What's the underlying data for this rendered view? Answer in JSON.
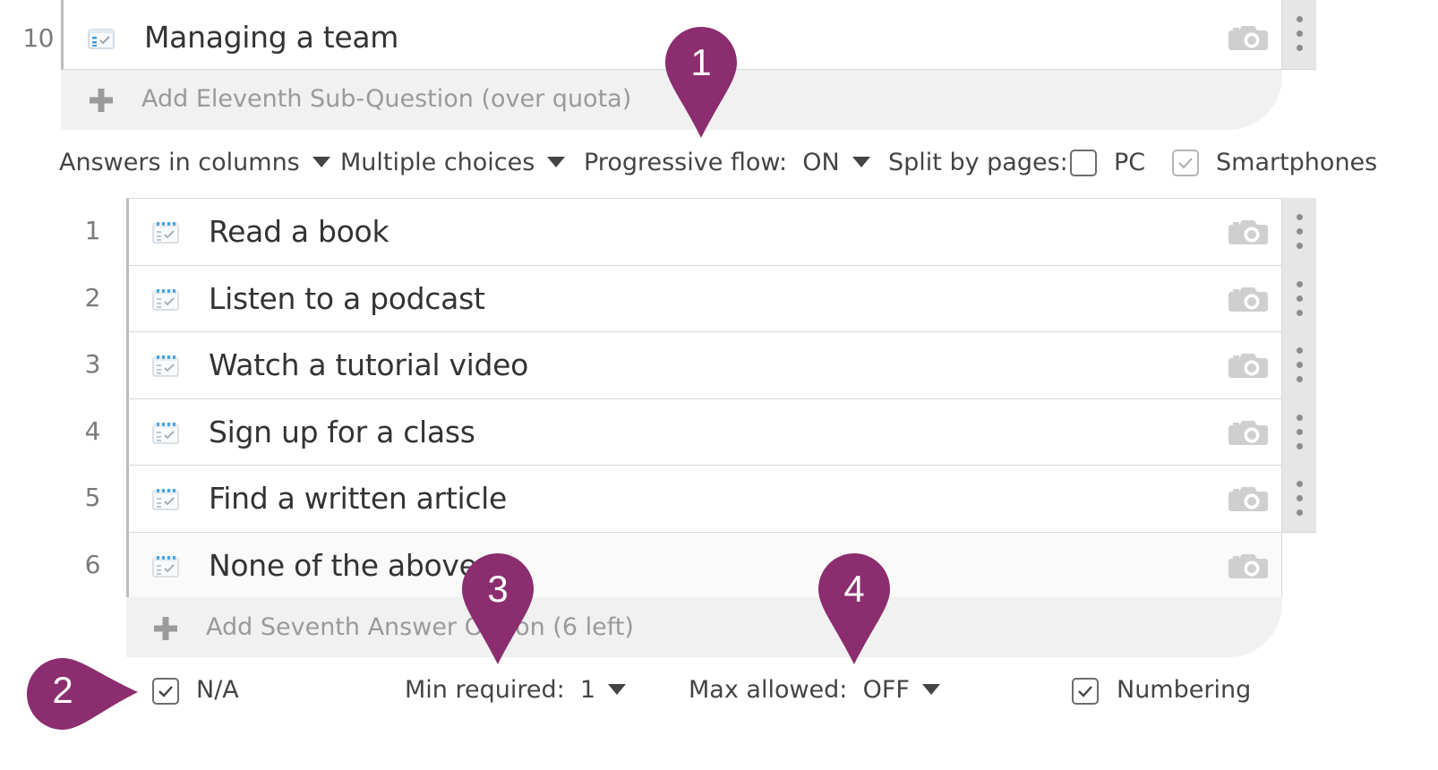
{
  "top_question": {
    "number": "10",
    "label": "Managing a team"
  },
  "add_sub_question": "Add Eleventh Sub-Question (over quota)",
  "toolbar": {
    "layout": "Answers in columns",
    "choice_type": "Multiple choices",
    "progressive_flow": "Progressive flow:  ON",
    "split_label": "Split by pages:",
    "pc_label": "PC",
    "pc_checked": false,
    "smartphones_label": "Smartphones",
    "smartphones_checked": true
  },
  "answers": [
    {
      "number": "1",
      "label": "Read a book"
    },
    {
      "number": "2",
      "label": "Listen to a podcast"
    },
    {
      "number": "3",
      "label": "Watch a tutorial video"
    },
    {
      "number": "4",
      "label": "Sign up for a class"
    },
    {
      "number": "5",
      "label": "Find a written article"
    },
    {
      "number": "6",
      "label": "None of the above"
    }
  ],
  "add_answer": "Add Seventh Answer Option (6 left)",
  "footer": {
    "na_label": "N/A",
    "na_checked": true,
    "min_required": "Min required:  1",
    "max_allowed": "Max allowed:  OFF",
    "numbering_label": "Numbering",
    "numbering_checked": true
  },
  "callouts": [
    "1",
    "2",
    "3",
    "4"
  ],
  "colors": {
    "callout": "#8b2d6f",
    "kebab_bg": "#e6e6e6",
    "add_bar_bg": "#f1f1f1"
  }
}
